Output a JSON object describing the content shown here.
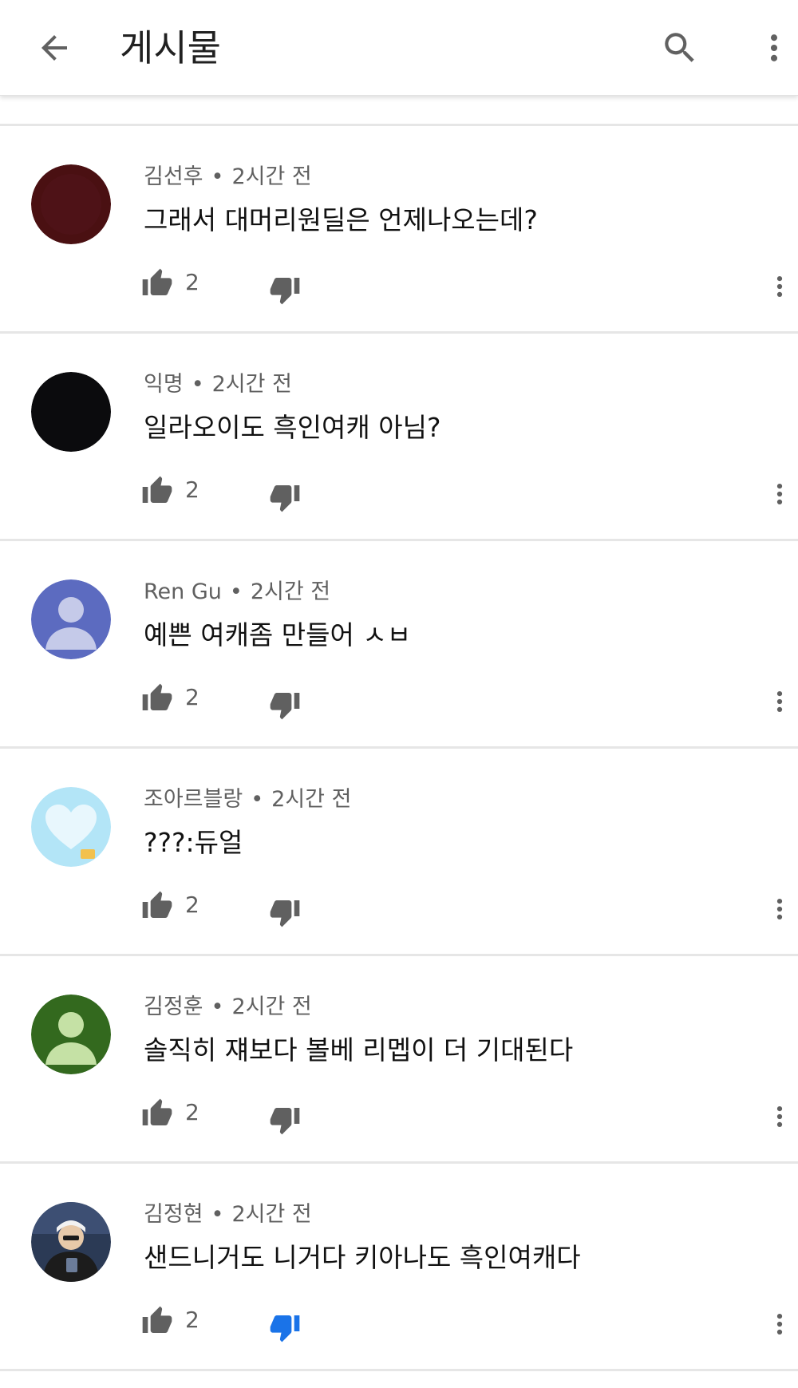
{
  "header": {
    "title": "게시물",
    "back_icon": "arrow-left-icon",
    "search_icon": "search-icon",
    "more_icon": "more-vertical-icon"
  },
  "colors": {
    "accent_blue": "#1a73e8",
    "icon_gray": "#606060"
  },
  "comments": [
    {
      "author": "김선후",
      "time": "2시간 전",
      "text": "그래서 대머리원딜은 언제나오는데?",
      "likes": "2",
      "avatar": "dark-red-avatar",
      "disliked": false
    },
    {
      "author": "익명",
      "time": "2시간 전",
      "text": "일라오이도 흑인여캐 아님?",
      "likes": "2",
      "avatar": "black-avatar",
      "disliked": false
    },
    {
      "author": "Ren Gu",
      "time": "2시간 전",
      "text": "예쁜 여캐좀 만들어 ㅅㅂ",
      "likes": "2",
      "avatar": "default-person-avatar",
      "disliked": false
    },
    {
      "author": "조아르블랑",
      "time": "2시간 전",
      "text": "???:듀얼",
      "likes": "2",
      "avatar": "heart-avatar",
      "disliked": false
    },
    {
      "author": "김정훈",
      "time": "2시간 전",
      "text": "솔직히 쟤보다 볼베 리멥이 더 기대된다",
      "likes": "2",
      "avatar": "default-person-avatar",
      "disliked": false
    },
    {
      "author": "김정현",
      "time": "2시간 전",
      "text": "샌드니거도 니거다 키아나도 흑인여캐다",
      "likes": "2",
      "avatar": "photo-avatar",
      "disliked": true
    }
  ],
  "separator": "•"
}
